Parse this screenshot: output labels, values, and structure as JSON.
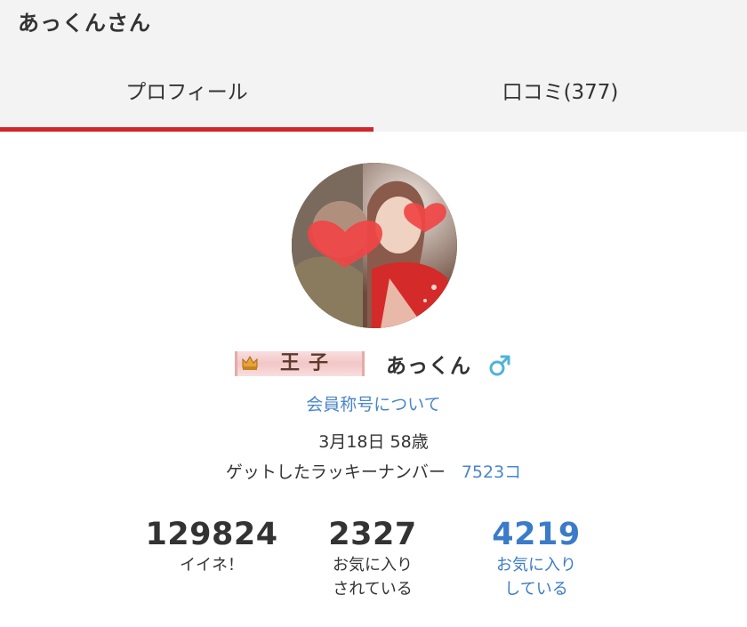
{
  "header": {
    "title": "あっくんさん"
  },
  "tabs": [
    {
      "label": "プロフィール",
      "active": true
    },
    {
      "label": "口コミ(377)",
      "active": false
    }
  ],
  "profile": {
    "title_badge": "王子",
    "title_badge_icon": "crown-icon",
    "username": "あっくん",
    "gender_icon": "male-icon",
    "rank_link": "会員称号について",
    "birth_age": "3月18日 58歳",
    "lucky_label": "ゲットしたラッキーナンバー",
    "lucky_value": "7523コ"
  },
  "stats": [
    {
      "value": "129824",
      "label_line1": "イイネ！",
      "label_line2": ""
    },
    {
      "value": "2327",
      "label_line1": "お気に入り",
      "label_line2": "されている"
    },
    {
      "value": "4219",
      "label_line1": "お気に入り",
      "label_line2": "している"
    }
  ],
  "colors": {
    "accent_red": "#d0262a",
    "link_blue": "#4a86c8",
    "tab_bg": "#f3f3f3"
  }
}
